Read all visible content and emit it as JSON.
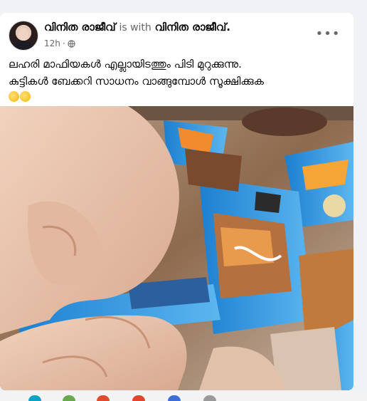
{
  "post": {
    "author_name": "വിനിത രാജീവ്",
    "with_text": "is with",
    "tagged_name": "വിനിത രാജീവ്.",
    "time": "12h",
    "privacy_icon": "globe-icon",
    "more_icon": "more-icon",
    "more_label": "•••",
    "text_line1": "ലഹരി മാഫിയകൾ എല്ലായിടത്തും പിടി മുറുക്കുന്നു.",
    "text_line2": "കുട്ടികൾ ബേക്കറി സാധനം വാങ്ങുമ്പോൾ സൂക്ഷിക്കുക",
    "emojis": [
      "thinking-face-icon",
      "thinking-face-icon"
    ]
  },
  "colors": {
    "background": "#f0f2f5",
    "card": "#ffffff",
    "primary_text": "#050505",
    "secondary_text": "#65676b",
    "wrapper_blue": "#2f8fd6"
  }
}
